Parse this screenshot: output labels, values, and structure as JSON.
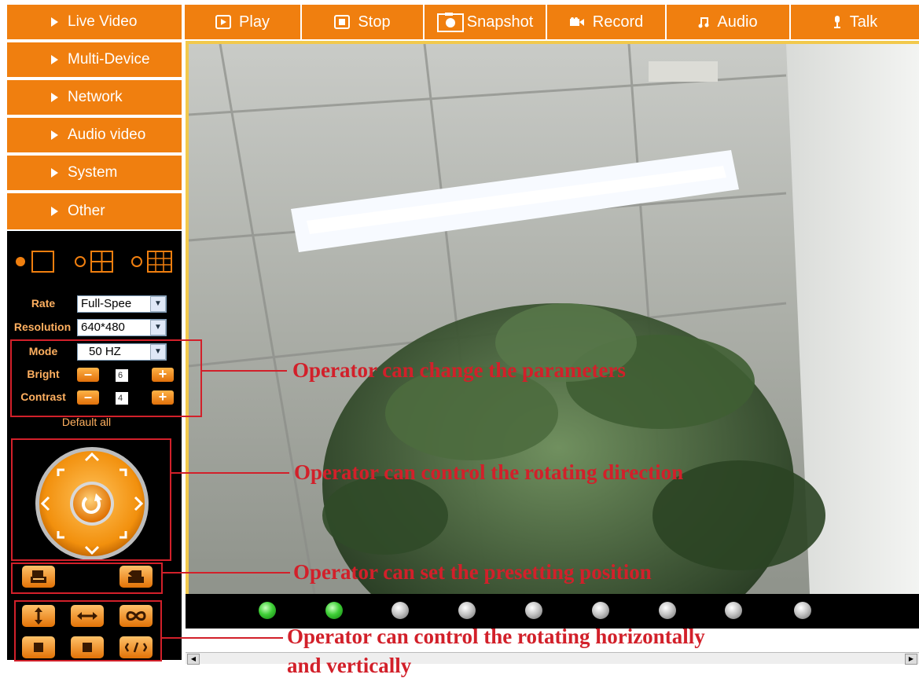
{
  "sidebar": {
    "items": [
      {
        "label": "Live Video"
      },
      {
        "label": "Multi-Device"
      },
      {
        "label": "Network"
      },
      {
        "label": "Audio video"
      },
      {
        "label": "System"
      },
      {
        "label": "Other"
      }
    ]
  },
  "toolbar": {
    "play_label": "Play",
    "stop_label": "Stop",
    "snapshot_label": "Snapshot",
    "record_label": "Record",
    "audio_label": "Audio",
    "talk_label": "Talk"
  },
  "layout_selector": {
    "options": [
      "single-view",
      "quad-view",
      "nine-view"
    ],
    "selected": "single-view"
  },
  "settings": {
    "rate_label": "Rate",
    "rate_value": "Full-Spee",
    "resolution_label": "Resolution",
    "resolution_value": "640*480",
    "mode_label": "Mode",
    "mode_value": "50 HZ",
    "bright_label": "Bright",
    "bright_value": "6",
    "contrast_label": "Contrast",
    "contrast_value": "4",
    "default_all_label": "Default all"
  },
  "channel_status": {
    "indicators": [
      "green",
      "green",
      "grey",
      "grey",
      "grey",
      "grey",
      "grey",
      "grey",
      "grey"
    ]
  },
  "annotations": {
    "parameters": "Operator can change the parameters",
    "direction": "Operator can control the rotating direction",
    "preset": "Operator can set the presetting position",
    "rotate_line1": "Operator can control the rotating horizontally",
    "rotate_line2": "and vertically"
  },
  "colors": {
    "accent": "#f07f0f",
    "annotation": "#d2202a",
    "panel_bg": "#000000"
  }
}
